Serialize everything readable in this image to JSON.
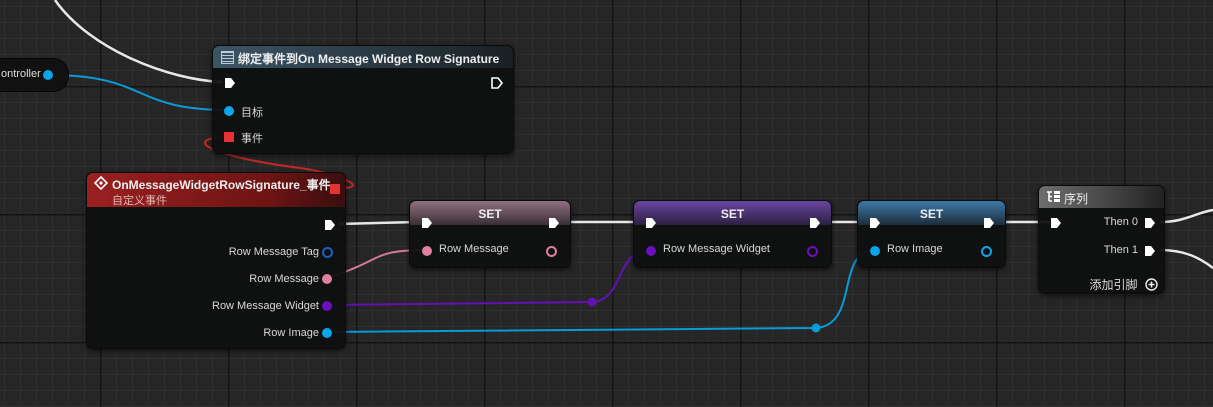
{
  "colors": {
    "exec": "#ffffff",
    "object": "#0aa6e8",
    "delegate": "#e53232",
    "string": "#e07fa0",
    "widget_ref": "#6c0fbf",
    "event_header": "#8b1c1c",
    "set_header_pink": "#8c6c78",
    "set_header_purple": "#5c3d8c",
    "set_header_blue": "#3a6f98",
    "sequence_header": "#6b6b6b"
  },
  "variable": {
    "label": "ontroller",
    "pin_icon": "object-pin-icon"
  },
  "bind_node": {
    "title": "绑定事件到On Message Widget Row Signature",
    "icon": "function-icon",
    "pins": {
      "target": "目标",
      "event": "事件"
    }
  },
  "custom_event": {
    "title": "OnMessageWidgetRowSignature_事件",
    "subtitle": "自定义事件",
    "icon": "event-diamond-icon",
    "pins": [
      "Row Message Tag",
      "Row Message",
      "Row Message Widget",
      "Row Image"
    ]
  },
  "set_nodes": [
    {
      "title": "SET",
      "pin_label": "Row Message"
    },
    {
      "title": "SET",
      "pin_label": "Row Message Widget"
    },
    {
      "title": "SET",
      "pin_label": "Row Image"
    }
  ],
  "sequence": {
    "title": "序列",
    "icon": "sequence-icon",
    "outputs": [
      "Then 0",
      "Then 1"
    ],
    "add_pin": "添加引脚",
    "add_icon": "plus-circle-icon"
  }
}
